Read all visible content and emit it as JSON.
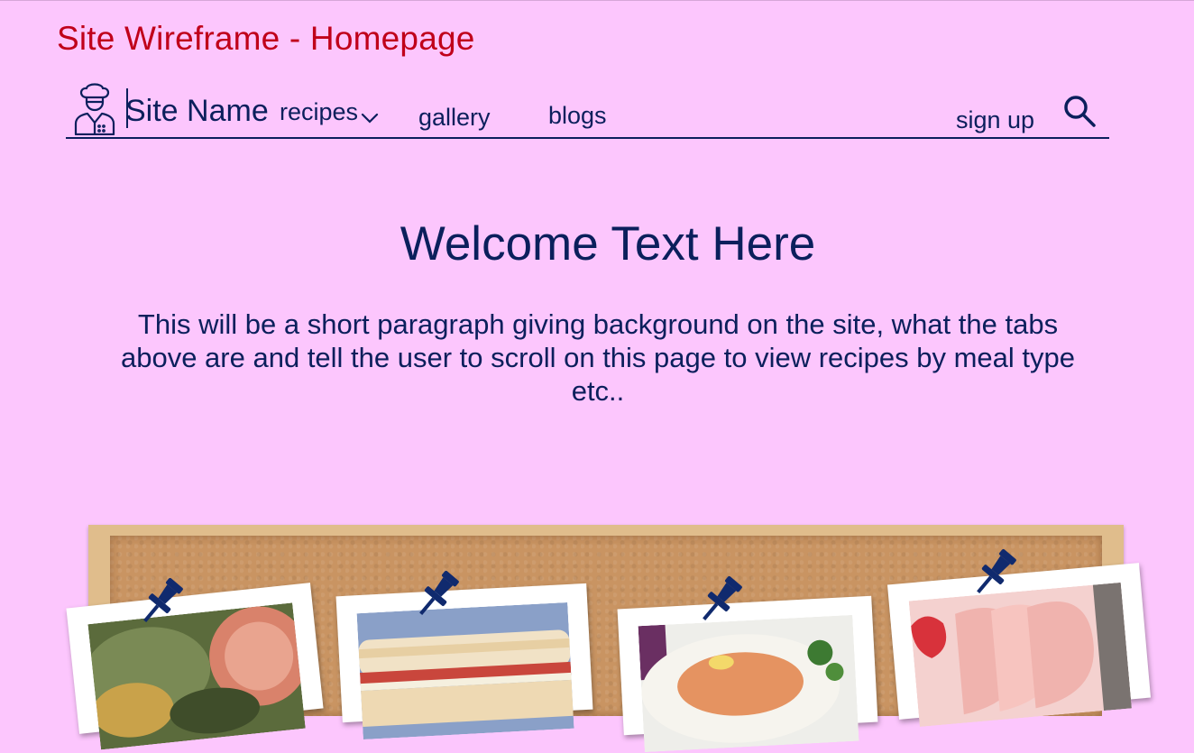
{
  "page_heading": "Site Wireframe - Homepage",
  "nav": {
    "site_name": "Site Name",
    "items": [
      {
        "label": "recipes",
        "has_dropdown": true
      },
      {
        "label": "gallery"
      },
      {
        "label": "blogs"
      }
    ],
    "sign_up": "sign up",
    "search_icon": "search-icon",
    "logo_icon": "chef-icon"
  },
  "hero": {
    "title": "Welcome Text Here",
    "paragraph": "This will be a short paragraph giving background on the site, what the tabs above are and tell the user to scroll on this page to view recipes by meal type etc.."
  },
  "colors": {
    "background": "#fcc6fd",
    "heading_red": "#c0001a",
    "navy": "#0b1f5c",
    "cork": "#c99462"
  },
  "corkboard": {
    "photos": [
      {
        "icon": "food-photo-salad"
      },
      {
        "icon": "food-photo-sandwich"
      },
      {
        "icon": "food-photo-salmon"
      },
      {
        "icon": "food-photo-strawberry-dessert"
      }
    ],
    "pin_icon": "push-pin-icon"
  }
}
